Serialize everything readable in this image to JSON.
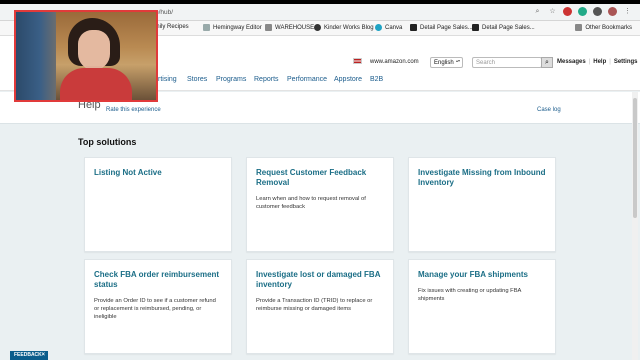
{
  "browser": {
    "url": "p/hub/",
    "bookmarks": [
      {
        "label": "y Family Recipes",
        "icon": "bookmark-icon"
      },
      {
        "label": "Hemingway Editor",
        "icon": "bookmark-icon"
      },
      {
        "label": "WAREHOUSE",
        "icon": "folder-icon"
      },
      {
        "label": "Kinder Works Blog",
        "icon": "globe-icon"
      },
      {
        "label": "Canva",
        "icon": "canva-icon"
      },
      {
        "label": "Detail Page Sales...",
        "icon": "amazon-icon"
      },
      {
        "label": "Detail Page Sales...",
        "icon": "amazon-icon"
      }
    ],
    "other_bookmarks": "Other Bookmarks"
  },
  "header": {
    "site_domain": "www.amazon.com",
    "language": "English",
    "search_placeholder": "Search",
    "links": [
      "Messages",
      "Help",
      "Settings"
    ],
    "link_separator": "|"
  },
  "nav": {
    "items": [
      "rtising",
      "Stores",
      "Programs",
      "Reports",
      "Performance",
      "Appstore",
      "B2B"
    ]
  },
  "help": {
    "title": "Help",
    "rate_link": "Rate this experience",
    "case_log": "Case log",
    "section_title": "Top solutions"
  },
  "cards": [
    {
      "title": "Listing Not Active",
      "desc": ""
    },
    {
      "title": "Request Customer Feedback Removal",
      "desc": "Learn when and how to request removal of customer feedback"
    },
    {
      "title": "Investigate Missing from Inbound Inventory",
      "desc": ""
    },
    {
      "title": "Check FBA order reimbursement status",
      "desc": "Provide an Order ID to see if a customer refund or replacement is reimbursed, pending, or ineligible"
    },
    {
      "title": "Investigate lost or damaged FBA inventory",
      "desc": "Provide a Transaction ID (TRID) to replace or reimburse missing or damaged items"
    },
    {
      "title": "Manage your FBA shipments",
      "desc": "Fix issues with creating or updating FBA shipments"
    }
  ],
  "feedback": {
    "label": "FEEDBACK",
    "close": "×"
  },
  "colors": {
    "link": "#1b5c8c",
    "card_title": "#1b6e86",
    "page_bg": "#eaf0f2",
    "feedback_bg": "#0b5d8c"
  }
}
